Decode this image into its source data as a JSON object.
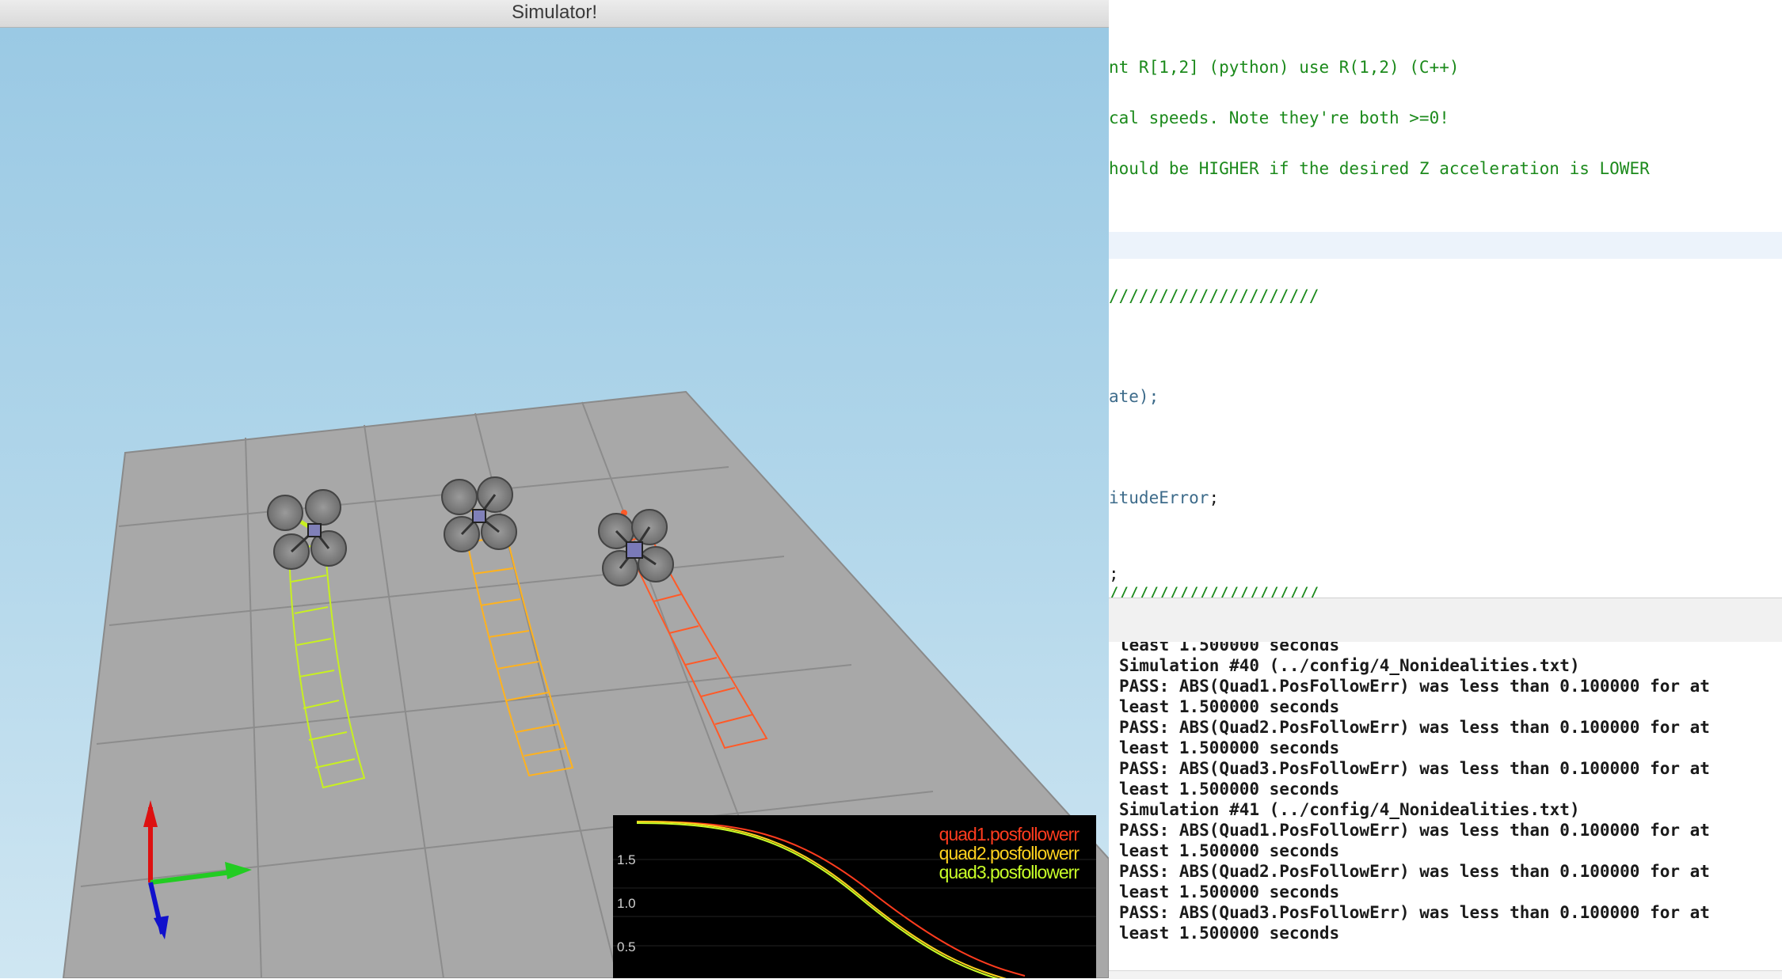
{
  "simulator": {
    "title": "Simulator!",
    "plot": {
      "legend": [
        "quad1.posfollowerr",
        "quad2.posfollowerr",
        "quad3.posfollowerr"
      ],
      "yticks": [
        "1.5",
        "1.0",
        "0.5"
      ],
      "colors": [
        "#ff3c1e",
        "#ffd21e",
        "#c8ff28"
      ]
    },
    "axes_gizmo": {
      "x": "#22cc22",
      "y": "#dd1111",
      "z": "#1111cc"
    }
  },
  "editor": {
    "lines": [
      "nt R[1,2] (python) use R(1,2) (C++)",
      "cal speeds. Note they're both >=0!",
      "hould be HIGHER if the desired Z acceleration is LOWER",
      "/////////////////////",
      "ate);",
      "itudeError",
      ";",
      "/////////////////////"
    ],
    "dark_suffix_1": ")",
    "dark_suffix_2": ";"
  },
  "console": {
    "lines": [
      "least 1.500000 seconds",
      "Simulation #40 (../config/4_Nonidealities.txt)",
      "PASS: ABS(Quad1.PosFollowErr) was less than 0.100000 for at",
      "least 1.500000 seconds",
      "PASS: ABS(Quad2.PosFollowErr) was less than 0.100000 for at",
      "least 1.500000 seconds",
      "PASS: ABS(Quad3.PosFollowErr) was less than 0.100000 for at",
      "least 1.500000 seconds",
      "Simulation #41 (../config/4_Nonidealities.txt)",
      "PASS: ABS(Quad1.PosFollowErr) was less than 0.100000 for at",
      "least 1.500000 seconds",
      "PASS: ABS(Quad2.PosFollowErr) was less than 0.100000 for at",
      "least 1.500000 seconds",
      "PASS: ABS(Quad3.PosFollowErr) was less than 0.100000 for at",
      "least 1.500000 seconds"
    ]
  }
}
